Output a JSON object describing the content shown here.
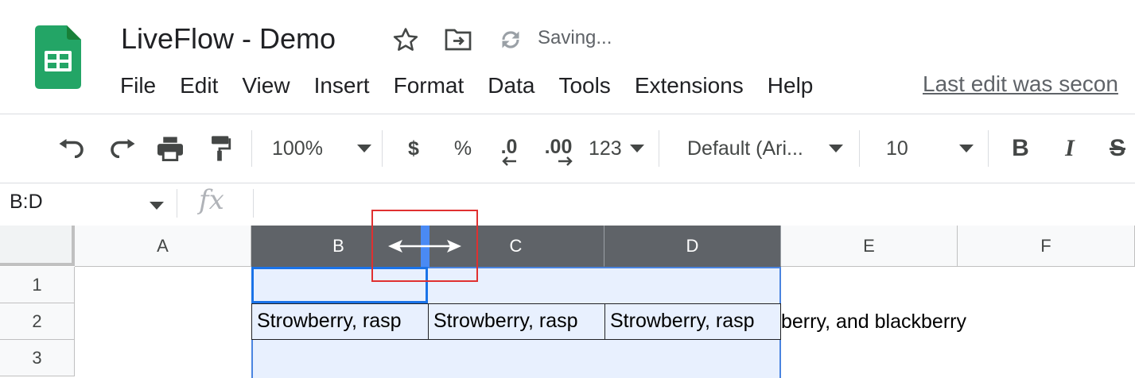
{
  "app": {
    "title": "LiveFlow - Demo",
    "status": "Saving...",
    "last_edit": "Last edit was secon"
  },
  "menu": [
    "File",
    "Edit",
    "View",
    "Insert",
    "Format",
    "Data",
    "Tools",
    "Extensions",
    "Help"
  ],
  "toolbar": {
    "zoom": "100%",
    "currency": "$",
    "percent": "%",
    "decrease_decimals": ".0",
    "increase_decimals": ".00",
    "more_formats": "123",
    "font": "Default (Ari...",
    "font_size": "10",
    "bold": "B",
    "italic": "I",
    "strikethrough": "S"
  },
  "formula_bar": {
    "name_box": "B:D",
    "fx_label": "fx",
    "value": ""
  },
  "sheet": {
    "columns": [
      "A",
      "B",
      "C",
      "D",
      "E",
      "F"
    ],
    "rows": [
      "1",
      "2",
      "3"
    ],
    "selected_columns": [
      "B",
      "C",
      "D"
    ],
    "cells": {
      "B2": "Strowberry, rasp",
      "C2": "Strowberry, rasp",
      "D2": "Strowberry, rasp",
      "D2_overflow": "berry, and blackberry"
    }
  },
  "colors": {
    "sheets_green": "#23a566",
    "selection_fill": "#e8f0fe",
    "selection_border": "#1a73e8",
    "selected_header": "#5f6368",
    "annotation_red": "#e03030"
  },
  "icons": [
    "sheets-logo-icon",
    "star-icon",
    "move-folder-icon",
    "sync-icon",
    "undo-icon",
    "redo-icon",
    "print-icon",
    "paint-format-icon",
    "resize-arrow-icon"
  ]
}
